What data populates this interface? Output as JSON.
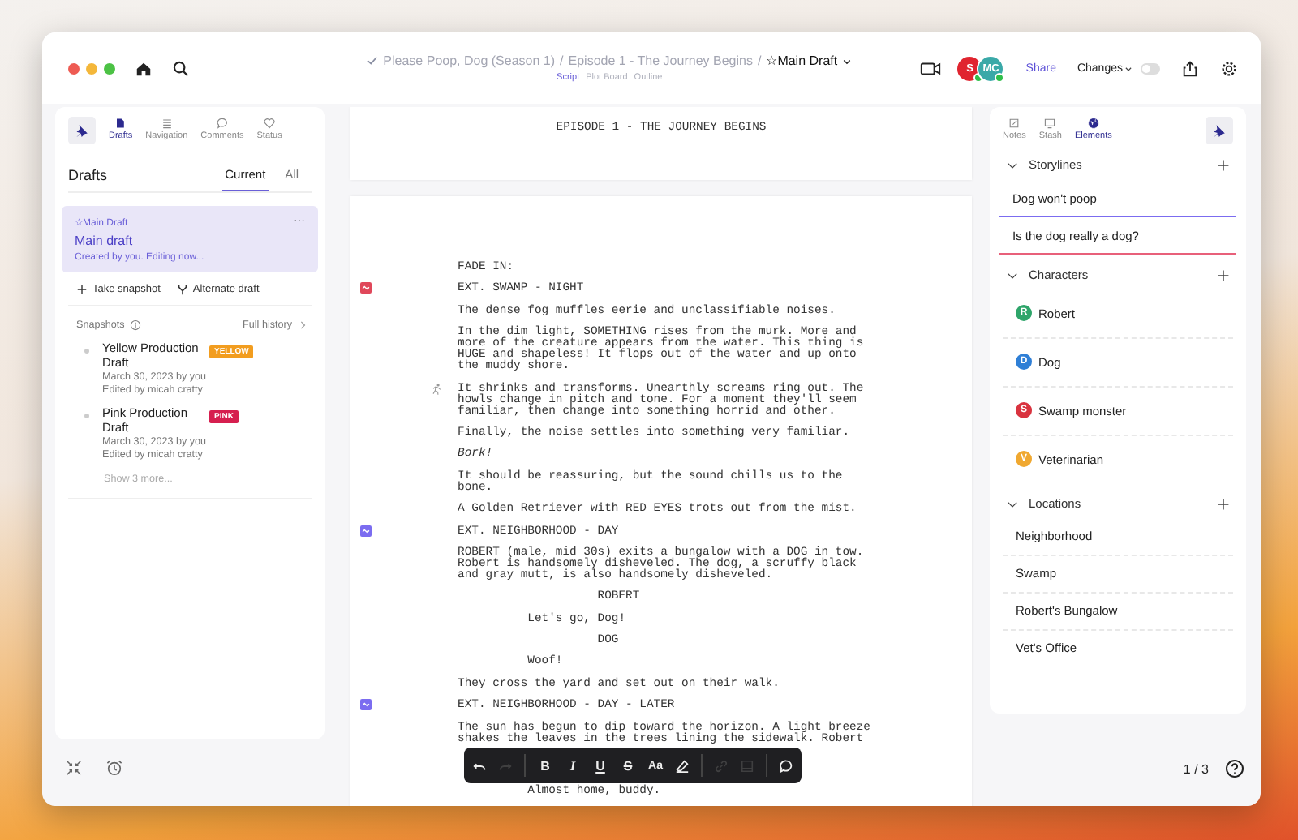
{
  "header": {
    "breadcrumb": [
      "Please Poop, Dog (Season 1)",
      "Episode 1 - The Journey Begins"
    ],
    "separator": "/",
    "draft": "☆Main Draft",
    "view_tabs": [
      {
        "label": "Script",
        "selected": true
      },
      {
        "label": "Plot Board",
        "selected": false
      },
      {
        "label": "Outline",
        "selected": false
      }
    ],
    "collaborators": [
      {
        "initials": "S",
        "color": "#e0242f",
        "online": true
      },
      {
        "initials": "MC",
        "color": "#3aa9a8",
        "online": true
      }
    ],
    "share": "Share",
    "changes": {
      "label": "Changes",
      "on": false
    }
  },
  "left_panel": {
    "tabs": [
      {
        "label": "Drafts",
        "kind": "drafts",
        "selected": true
      },
      {
        "label": "Navigation",
        "kind": "navigation",
        "selected": false
      },
      {
        "label": "Comments",
        "kind": "comments",
        "selected": false
      },
      {
        "label": "Status",
        "kind": "status",
        "selected": false
      }
    ],
    "title": "Drafts",
    "scope_tabs": [
      {
        "label": "Current",
        "selected": true
      },
      {
        "label": "All",
        "selected": false
      }
    ],
    "current_draft": {
      "tag": "☆Main Draft",
      "menu": "···",
      "name": "Main draft",
      "status": "Created by you. Editing now..."
    },
    "actions": [
      {
        "label": "Take snapshot",
        "kind": "snapshot"
      },
      {
        "label": "Alternate draft",
        "kind": "branch"
      }
    ],
    "snapshots": {
      "title": "Snapshots",
      "history": "Full history",
      "items": [
        {
          "name": "Yellow Production Draft",
          "badge": "YELLOW",
          "color": "#f29d1f",
          "date": "March 30, 2023 by you",
          "edited": "Edited by micah cratty"
        },
        {
          "name": "Pink Production Draft",
          "badge": "PINK",
          "color": "#d61f4f",
          "date": "March 30, 2023 by you",
          "edited": "Edited by micah cratty"
        }
      ],
      "more": "Show 3 more..."
    }
  },
  "script": {
    "title_page": "EPISODE 1 - THE JOURNEY BEGINS",
    "lines": [
      {
        "kind": "transition",
        "text": "FADE IN:",
        "marked": false
      },
      {
        "kind": "scene",
        "text": "EXT. SWAMP - NIGHT",
        "color": "#e0475a",
        "marked": false
      },
      {
        "kind": "action",
        "text": "The dense fog muffles eerie and unclassifiable noises.",
        "marked": false
      },
      {
        "kind": "action",
        "text": "In the dim light, SOMETHING rises from the murk. More and more of the creature appears from the water. This thing is HUGE and shapeless! It flops out of the water and up onto the muddy shore.",
        "marked": false
      },
      {
        "kind": "action",
        "text": "It shrinks and transforms. Unearthly screams ring out. The howls change in pitch and tone. For a moment they'll seem familiar, then change into something horrid and other.",
        "marked": true
      },
      {
        "kind": "action",
        "text": "Finally, the noise settles into something very familiar.",
        "marked": false
      },
      {
        "kind": "action",
        "text": "*Bork!*",
        "marked": false
      },
      {
        "kind": "action",
        "text": "It should be reassuring, but the sound chills us to the bone.",
        "marked": false
      },
      {
        "kind": "action",
        "text": "A Golden Retriever with RED EYES trots out from the mist.",
        "marked": false
      },
      {
        "kind": "scene",
        "text": "EXT. NEIGHBORHOOD - DAY",
        "color": "#7b6cf0",
        "marked": false
      },
      {
        "kind": "action",
        "text": "ROBERT (male, mid 30s) exits a bungalow with a DOG in tow. Robert is handsomely disheveled. The dog, a scruffy black and gray mutt, is also handsomely disheveled.",
        "marked": false
      },
      {
        "kind": "character",
        "text": "ROBERT",
        "marked": false
      },
      {
        "kind": "dialogue",
        "text": "Let's go, Dog!",
        "marked": false
      },
      {
        "kind": "character",
        "text": "DOG",
        "marked": false
      },
      {
        "kind": "dialogue",
        "text": "Woof!",
        "marked": false
      },
      {
        "kind": "action",
        "text": "They cross the yard and set out on their walk.",
        "marked": false
      },
      {
        "kind": "scene",
        "text": "EXT. NEIGHBORHOOD - DAY - LATER",
        "color": "#7b6cf0",
        "marked": false
      },
      {
        "kind": "action",
        "text": "The sun has begun to dip toward the horizon. A light breeze shakes the leaves in the trees lining the sidewalk. Robert",
        "marked": false
      },
      {
        "kind": "dialogue",
        "text": "Almost home, buddy.",
        "marked": false
      }
    ]
  },
  "toolbar": [
    [
      {
        "kind": "undo",
        "disabled": false
      },
      {
        "kind": "redo",
        "disabled": true
      }
    ],
    [
      {
        "kind": "bold",
        "label": "B",
        "disabled": false
      },
      {
        "kind": "italic",
        "label": "I",
        "disabled": false
      },
      {
        "kind": "underline",
        "label": "U",
        "disabled": false
      },
      {
        "kind": "strike",
        "label": "S",
        "disabled": false
      },
      {
        "kind": "case",
        "label": "Aa",
        "disabled": false
      },
      {
        "kind": "eraser",
        "disabled": false
      }
    ],
    [
      {
        "kind": "link",
        "disabled": true
      },
      {
        "kind": "note",
        "disabled": true
      }
    ],
    [
      {
        "kind": "comment",
        "disabled": false
      }
    ]
  ],
  "right_panel": {
    "tabs": [
      {
        "label": "Notes",
        "kind": "notes",
        "selected": false
      },
      {
        "label": "Stash",
        "kind": "stash",
        "selected": false
      },
      {
        "label": "Elements",
        "kind": "elements",
        "selected": true
      }
    ],
    "sections": [
      {
        "title": "Storylines",
        "kind": "storylines",
        "items": [
          {
            "name": "Dog won't poop",
            "color": "#7b6cf0"
          },
          {
            "name": "Is the dog really a dog?",
            "color": "#e8607a"
          }
        ]
      },
      {
        "title": "Characters",
        "kind": "characters",
        "items": [
          {
            "name": "Robert",
            "initial": "R",
            "color": "#2ea56a"
          },
          {
            "name": "Dog",
            "initial": "D",
            "color": "#2f7fd6"
          },
          {
            "name": "Swamp monster",
            "initial": "S",
            "color": "#d9333f"
          },
          {
            "name": "Veterinarian",
            "initial": "V",
            "color": "#f0a830"
          }
        ]
      },
      {
        "title": "Locations",
        "kind": "locations",
        "items": [
          {
            "name": "Neighborhood"
          },
          {
            "name": "Swamp"
          },
          {
            "name": "Robert's Bungalow"
          },
          {
            "name": "Vet's Office"
          }
        ]
      }
    ]
  },
  "footer": {
    "page": "1 / 3"
  }
}
